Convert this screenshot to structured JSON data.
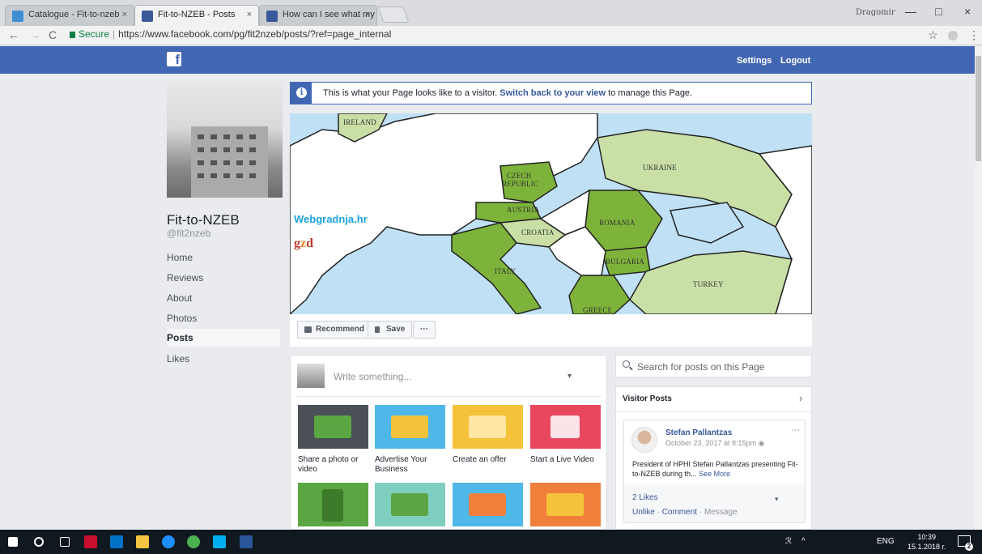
{
  "browser": {
    "tabs": [
      {
        "title": "Catalogue - Fit-to-nzeb",
        "active": false
      },
      {
        "title": "Fit-to-NZEB - Posts",
        "active": true
      },
      {
        "title": "How can I see what my P",
        "active": false
      }
    ],
    "tab_close": "×",
    "window_user": "Dragomir",
    "window_buttons": [
      "—",
      "□",
      "×"
    ],
    "nav": {
      "back": "←",
      "forward": "→",
      "reload": "C"
    },
    "secure_label": "Secure",
    "url_sep": "|",
    "url": "https://www.facebook.com/pg/fit2nzeb/posts/?ref=page_internal",
    "star": "☆",
    "menu": "⋮"
  },
  "fb_header": {
    "logo": "f",
    "settings": "Settings",
    "logout": "Logout"
  },
  "page": {
    "name": "Fit-to-NZEB",
    "handle": "@fit2nzeb",
    "nav": [
      {
        "label": "Home",
        "active": false
      },
      {
        "label": "Reviews",
        "active": false
      },
      {
        "label": "About",
        "active": false
      },
      {
        "label": "Photos",
        "active": false
      },
      {
        "label": "Posts",
        "active": true
      },
      {
        "label": "Likes",
        "active": false
      }
    ]
  },
  "banner": {
    "icon": "i",
    "text_before": "This is what your Page looks like to a visitor. ",
    "link": "Switch back to your view",
    "text_after": " to manage this Page."
  },
  "cover_map": {
    "labels": [
      "Ireland",
      "Czech",
      "Republic",
      "Austria",
      "Croatia",
      "Italy",
      "Romania",
      "Bulgaria",
      "Greece",
      "Ukraine",
      "Turkey"
    ],
    "brand1": "Webgradnja.hr",
    "brand2_a": "g",
    "brand2_b": "z",
    "brand2_c": "d",
    "colors": {
      "sea": "#bfe0f5",
      "land": "#ffffff",
      "dark_green": "#7db33a",
      "light_green": "#c9dfa6",
      "border": "#222222"
    }
  },
  "actions": {
    "recommend": "Recommend",
    "save": "Save",
    "more": "···"
  },
  "composer": {
    "placeholder": "Write something...",
    "dropdown": "▾",
    "tiles": [
      {
        "label": "Share a photo or video",
        "color": "#4b4f56"
      },
      {
        "label": "Advertise Your Business",
        "color": "#4fb8e8"
      },
      {
        "label": "Create an offer",
        "color": "#f5c33b"
      },
      {
        "label": "Start a Live Video",
        "color": "#e8475e"
      },
      {
        "label": "",
        "color": "#5aa642"
      },
      {
        "label": "",
        "color": "#7fcfc1"
      },
      {
        "label": "",
        "color": "#4fb8e8"
      },
      {
        "label": "",
        "color": "#f07f3c"
      }
    ]
  },
  "search": {
    "placeholder": "Search for posts on this Page"
  },
  "visitor_posts": {
    "title": "Visitor Posts",
    "chevron": "›",
    "post": {
      "author": "Stefan Pallantzas",
      "date": "October 23, 2017 at 8:15pm",
      "privacy": "◉",
      "more": "···",
      "text": "President of HPHI Stefan Pallantzas presenting Fit-to-NZEB during th...",
      "see_more": "See More",
      "likes": "2 Likes",
      "audience": "▾",
      "unlike": "Unlike",
      "comment": "Comment",
      "message": "Message",
      "dot": " · "
    }
  },
  "taskbar": {
    "lang": "ENG",
    "time": "10:39",
    "date": "15.1.2018 r.",
    "notif_count": "2"
  }
}
